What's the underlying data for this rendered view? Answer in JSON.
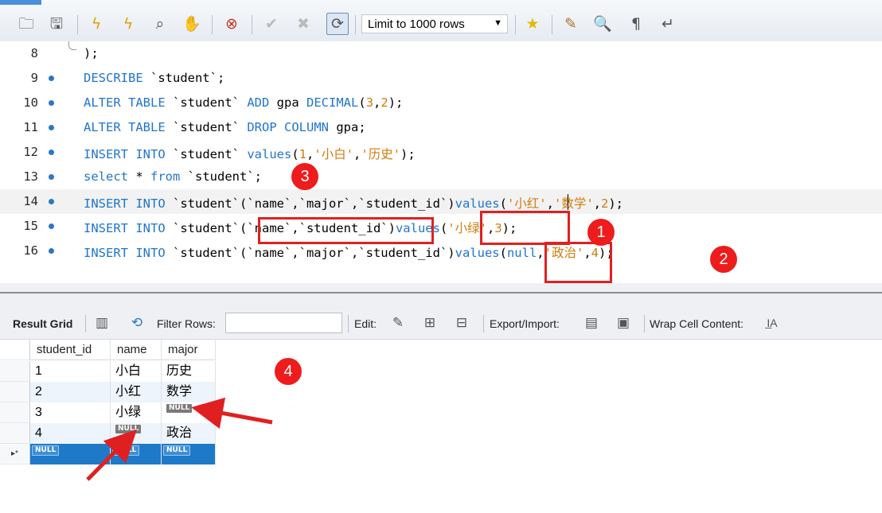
{
  "toolbar": {
    "limit_select": {
      "value": "Limit to 1000 rows"
    },
    "icons": [
      "folder-open-icon",
      "save-icon",
      "execute-icon",
      "execute-current-icon",
      "explain-icon",
      "stop-icon",
      "toggle-errors-icon",
      "commit-icon",
      "rollback-icon",
      "autocommit-icon",
      "add-snippet-icon",
      "beautify-icon",
      "find-icon",
      "invisible-chars-icon",
      "wrap-icon"
    ]
  },
  "editor": {
    "lines": [
      {
        "num": "8",
        "text": ");"
      },
      {
        "num": "9",
        "text": "DESCRIBE `student`;"
      },
      {
        "num": "10",
        "text": "ALTER TABLE `student` ADD gpa DECIMAL(3,2);"
      },
      {
        "num": "11",
        "text": "ALTER TABLE `student` DROP COLUMN gpa;"
      },
      {
        "num": "12",
        "text": "INSERT INTO `student` values(1,'小白','历史');"
      },
      {
        "num": "13",
        "text": "select * from `student`;"
      },
      {
        "num": "14",
        "text": "INSERT INTO `student`(`name`,`major`,`student_id`)values('小红','数学',2);"
      },
      {
        "num": "15",
        "text": "INSERT INTO `student`(`name`,`student_id`)values('小绿',3);"
      },
      {
        "num": "16",
        "text": "INSERT INTO `student`(`name`,`major`,`student_id`)values(null,'政治',4);"
      }
    ],
    "markers": [
      "1",
      "2",
      "3",
      "4"
    ]
  },
  "result_toolbar": {
    "result_grid": "Result Grid",
    "filter_rows": "Filter Rows:",
    "filter_value": "",
    "edit": "Edit:",
    "export_import": "Export/Import:",
    "wrap_cell": "Wrap Cell Content:"
  },
  "grid": {
    "columns": [
      "student_id",
      "name",
      "major"
    ],
    "rows": [
      [
        "1",
        "小白",
        "历史"
      ],
      [
        "2",
        "小红",
        "数学"
      ],
      [
        "3",
        "小绿",
        null
      ],
      [
        "4",
        null,
        "政治"
      ]
    ],
    "null_label": "NULL",
    "new_row_marker": "▸*"
  },
  "colors": {
    "keyword": "#1f75cc",
    "string": "#d27b0a",
    "annotation": "#e02020",
    "selection": "#1e79c8"
  }
}
